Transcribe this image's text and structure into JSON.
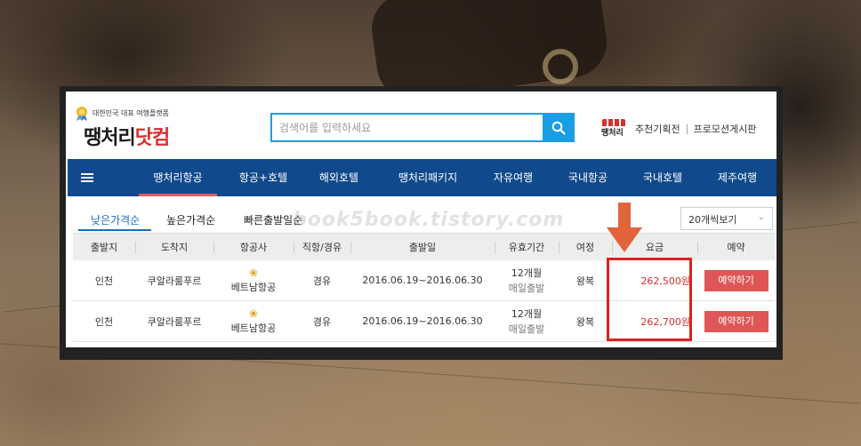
{
  "header": {
    "tagline": "대한민국 대표 여행플랫폼",
    "brand_part1": "땡처리",
    "brand_part2": "닷컴",
    "search_placeholder": "검색어를 입력하세요",
    "mini_logo": "땡처리",
    "links": [
      "추천기획전",
      "프로모션게시판"
    ]
  },
  "nav": {
    "items": [
      "땡처리항공",
      "항공+호텔",
      "해외호텔",
      "땡처리패키지",
      "자유여행",
      "국내항공",
      "국내호텔",
      "제주여행"
    ],
    "active_index": 0
  },
  "sort": {
    "tabs": [
      "낮은가격순",
      "높은가격순",
      "빠른출발일순"
    ],
    "active_index": 0,
    "per_page": "20개씩보기"
  },
  "watermark": "book5book.tistory.com",
  "table": {
    "headers": [
      "출발지",
      "도착지",
      "항공사",
      "직항/경유",
      "출발일",
      "유효기간",
      "여정",
      "요금",
      "예약"
    ],
    "rows": [
      {
        "origin": "인천",
        "destination": "쿠알라룸푸르",
        "airline": "베트남항공",
        "route_type": "경유",
        "dates": "2016.06.19~2016.06.30",
        "validity": "12개월",
        "validity_note": "매일출발",
        "trip": "왕복",
        "price": "262,500원",
        "book": "예약하기"
      },
      {
        "origin": "인천",
        "destination": "쿠알라룸푸르",
        "airline": "베트남항공",
        "route_type": "경유",
        "dates": "2016.06.19~2016.06.30",
        "validity": "12개월",
        "validity_note": "매일출발",
        "trip": "왕복",
        "price": "262,700원",
        "book": "예약하기"
      }
    ]
  },
  "colors": {
    "nav_bg": "#114a8c",
    "accent_blue": "#1a9ee3",
    "price_red": "#d62f2f",
    "book_button": "#e05555",
    "annotation_red": "#e02020",
    "annotation_arrow": "#e0643c"
  },
  "icons": [
    "award-badge-icon",
    "search-icon",
    "menu-icon",
    "chevron-down-icon",
    "airline-logo-icon",
    "down-arrow-icon"
  ]
}
